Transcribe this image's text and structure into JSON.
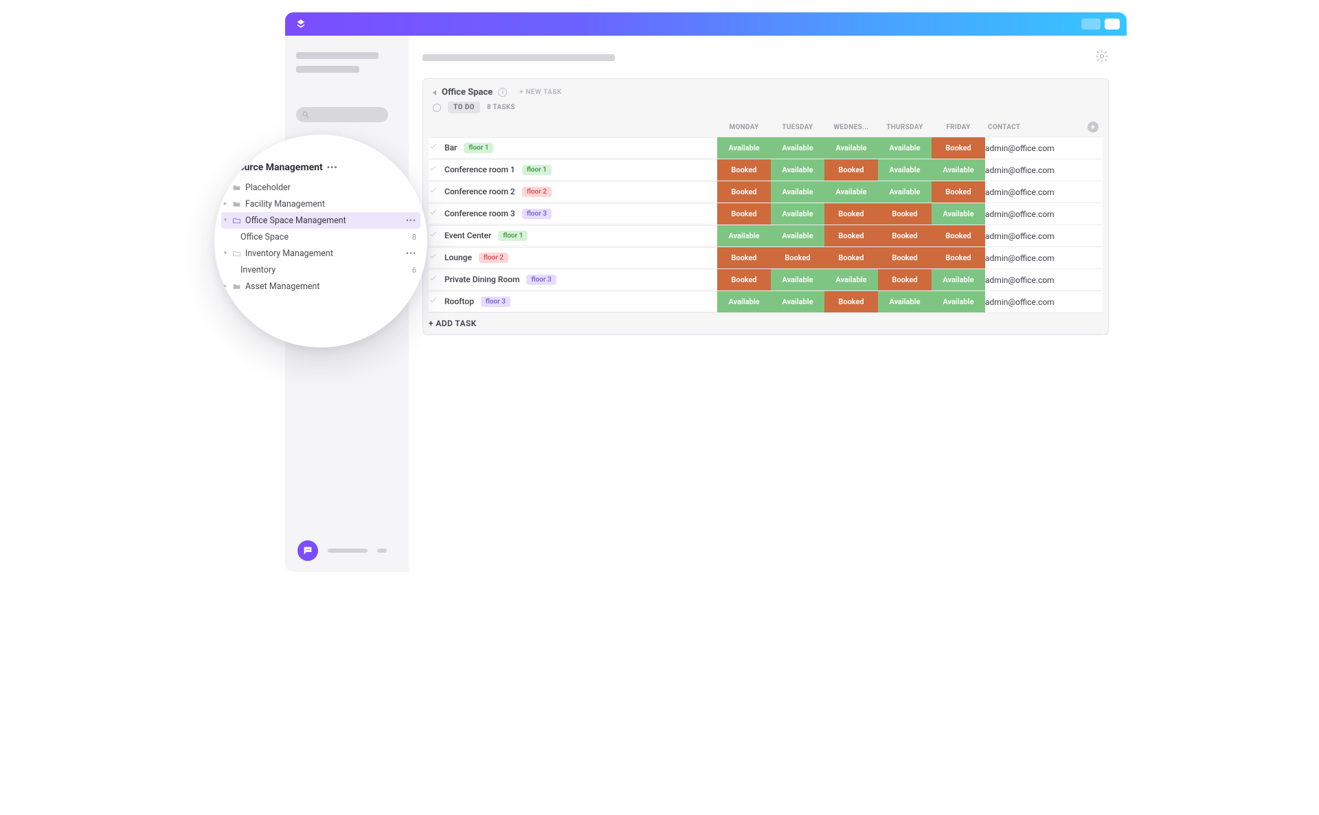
{
  "board": {
    "title": "Office Space",
    "new_task_label": "+ NEW TASK",
    "status_label": "TO DO",
    "task_count_label": "8 TASKS",
    "add_task_label": "+ ADD TASK",
    "columns": {
      "monday": "MONDAY",
      "tuesday": "TUESDAY",
      "wednesday": "WEDNES...",
      "thursday": "THURSDAY",
      "friday": "FRIDAY",
      "contact": "CONTACT"
    },
    "slot_labels": {
      "available": "Available",
      "booked": "Booked"
    },
    "rows": [
      {
        "name": "Bar",
        "tag_text": "floor 1",
        "tag_class": "green",
        "days": [
          "avail",
          "avail",
          "avail",
          "avail",
          "book"
        ],
        "contact": "admin@office.com"
      },
      {
        "name": "Conference room 1",
        "tag_text": "floor 1",
        "tag_class": "green",
        "days": [
          "book",
          "avail",
          "book",
          "avail",
          "avail"
        ],
        "contact": "admin@office.com"
      },
      {
        "name": "Conference room 2",
        "tag_text": "floor 2",
        "tag_class": "red",
        "days": [
          "book",
          "avail",
          "avail",
          "avail",
          "book"
        ],
        "contact": "admin@office.com"
      },
      {
        "name": "Conference room 3",
        "tag_text": "floor 3",
        "tag_class": "purple",
        "days": [
          "book",
          "avail",
          "book",
          "book",
          "avail"
        ],
        "contact": "admin@office.com"
      },
      {
        "name": "Event Center",
        "tag_text": "floor 1",
        "tag_class": "green",
        "days": [
          "avail",
          "avail",
          "book",
          "book",
          "book"
        ],
        "contact": "admin@office.com"
      },
      {
        "name": "Lounge",
        "tag_text": "floor 2",
        "tag_class": "red",
        "days": [
          "book",
          "book",
          "book",
          "book",
          "book"
        ],
        "contact": "admin@office.com"
      },
      {
        "name": "Private Dining Room",
        "tag_text": "floor 3",
        "tag_class": "purple",
        "days": [
          "book",
          "avail",
          "avail",
          "book",
          "avail"
        ],
        "contact": "admin@office.com"
      },
      {
        "name": "Rooftop",
        "tag_text": "floor 3",
        "tag_class": "purple",
        "days": [
          "avail",
          "avail",
          "book",
          "avail",
          "avail"
        ],
        "contact": "admin@office.com"
      }
    ]
  },
  "lens": {
    "title": "Resource Management",
    "items": {
      "placeholder": "Placeholder",
      "facility": "Facility Management",
      "office_mgmt": "Office Space Management",
      "office_space": "Office Space",
      "office_space_count": "8",
      "inventory_mgmt": "Inventory Management",
      "inventory": "Inventory",
      "inventory_count": "6",
      "asset": "Asset Management"
    }
  }
}
